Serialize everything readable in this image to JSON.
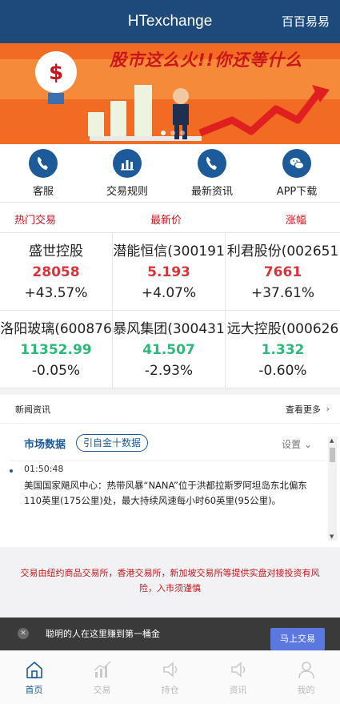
{
  "header": {
    "title": "HTexchange",
    "right_link": "百百易易"
  },
  "banner": {
    "slogan": "股市这么火!!你还等什么"
  },
  "quick_links": [
    {
      "label": "客服",
      "icon": "phone-icon"
    },
    {
      "label": "交易规则",
      "icon": "bar-chart-icon"
    },
    {
      "label": "最新资讯",
      "icon": "phone-icon"
    },
    {
      "label": "APP下载",
      "icon": "wechat-icon"
    }
  ],
  "market_table": {
    "headers": [
      "热门交易",
      "最新价",
      "涨幅"
    ],
    "cells": [
      {
        "name": "盛世控股",
        "price": "28058",
        "change": "+43.57%",
        "trend": "up"
      },
      {
        "name": "潜能恒信(300191",
        "price": "5.193",
        "change": "+4.07%",
        "trend": "up"
      },
      {
        "name": "利君股份(002651",
        "price": "7661",
        "change": "+37.61%",
        "trend": "up"
      },
      {
        "name": "洛阳玻璃(600876",
        "price": "11352.99",
        "change": "-0.05%",
        "trend": "down"
      },
      {
        "name": "暴风集团(300431",
        "price": "41.507",
        "change": "-2.93%",
        "trend": "down"
      },
      {
        "name": "远大控股(000626",
        "price": "1.332",
        "change": "-0.60%",
        "trend": "down"
      }
    ]
  },
  "news": {
    "title": "新闻资讯",
    "more": "查看更多",
    "feed_title": "市场数据",
    "feed_tag": "引自金十数据",
    "settings": "设置",
    "item": {
      "time": "01:50:48",
      "text": "美国国家飓风中心：热带风暴“NANA”位于洪都拉斯罗阿坦岛东北偏东110英里(175公里)处，最大持续风速每小时60英里(95公里)。"
    }
  },
  "notice": "交易由纽约商品交易所，香港交易所，新加坡交易所等提供实盘对接投资有风险，入市须谨慎",
  "promo": {
    "text": "聪明的人在这里赚到第一桶金",
    "button": "马上交易"
  },
  "tabbar": [
    {
      "label": "首页",
      "icon": "home-icon"
    },
    {
      "label": "交易",
      "icon": "chart-icon"
    },
    {
      "label": "持仓",
      "icon": "speaker-icon"
    },
    {
      "label": "资讯",
      "icon": "speaker-icon"
    },
    {
      "label": "我的",
      "icon": "user-icon"
    }
  ],
  "colors": {
    "header": "#1d4a7a",
    "up": "#d9343c",
    "down": "#2eb87a",
    "accent": "#1d5a9a",
    "banner": "#f26b22"
  }
}
